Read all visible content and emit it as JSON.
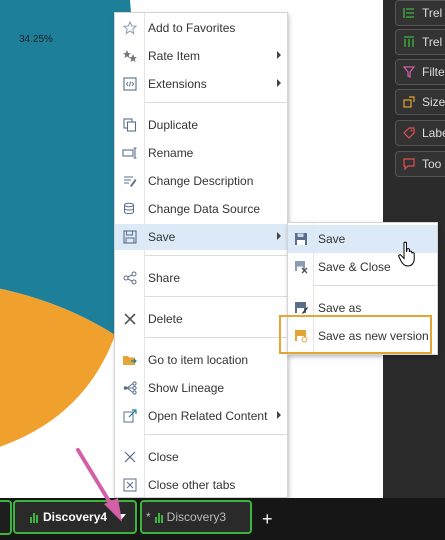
{
  "chart": {
    "slice_label": "34.25%",
    "colors": {
      "teal": "#1e7f9b",
      "orange": "#f0a02c"
    }
  },
  "right_panel": {
    "items": [
      {
        "label": "Trel",
        "icon": "rows-icon"
      },
      {
        "label": "Trel",
        "icon": "columns-icon"
      },
      {
        "label": "Filte",
        "icon": "filter-icon"
      },
      {
        "label": "Size",
        "icon": "size-icon"
      },
      {
        "label": "Labe",
        "icon": "tag-icon"
      },
      {
        "label": "Too",
        "icon": "tooltip-icon"
      }
    ]
  },
  "context_menu": {
    "items": [
      {
        "label": "Add to Favorites",
        "icon": "star-icon",
        "submenu": false
      },
      {
        "label": "Rate Item",
        "icon": "stars-icon",
        "submenu": true
      },
      {
        "label": "Extensions",
        "icon": "code-icon",
        "submenu": true
      },
      {
        "label": "Duplicate",
        "icon": "duplicate-icon",
        "submenu": false
      },
      {
        "label": "Rename",
        "icon": "rename-icon",
        "submenu": false
      },
      {
        "label": "Change Description",
        "icon": "description-icon",
        "submenu": false
      },
      {
        "label": "Change Data Source",
        "icon": "database-icon",
        "submenu": false
      },
      {
        "label": "Save",
        "icon": "save-icon",
        "submenu": true,
        "active": true
      },
      {
        "label": "Share",
        "icon": "share-icon",
        "submenu": false
      },
      {
        "label": "Delete",
        "icon": "delete-icon",
        "submenu": false
      },
      {
        "label": "Go to item location",
        "icon": "folder-icon",
        "submenu": false
      },
      {
        "label": "Show Lineage",
        "icon": "lineage-icon",
        "submenu": false
      },
      {
        "label": "Open Related Content",
        "icon": "related-icon",
        "submenu": true
      },
      {
        "label": "Close",
        "icon": "close-icon",
        "submenu": false
      },
      {
        "label": "Close other tabs",
        "icon": "close-tabs-icon",
        "submenu": false
      }
    ]
  },
  "save_submenu": {
    "items": [
      {
        "label": "Save",
        "icon": "save-icon"
      },
      {
        "label": "Save & Close",
        "icon": "save-close-icon"
      },
      {
        "label": "Save as",
        "icon": "save-as-icon"
      },
      {
        "label": "Save as new version",
        "icon": "save-new-version-icon"
      }
    ],
    "highlight_color": "#e3a535"
  },
  "tabs": {
    "active_label": "Discovery4",
    "inactive_label": "Discovery3",
    "inactive_modified": "*",
    "add_label": "+",
    "accent": "#3db53d"
  },
  "annotation": {
    "arrow_color": "#d35fa6"
  }
}
